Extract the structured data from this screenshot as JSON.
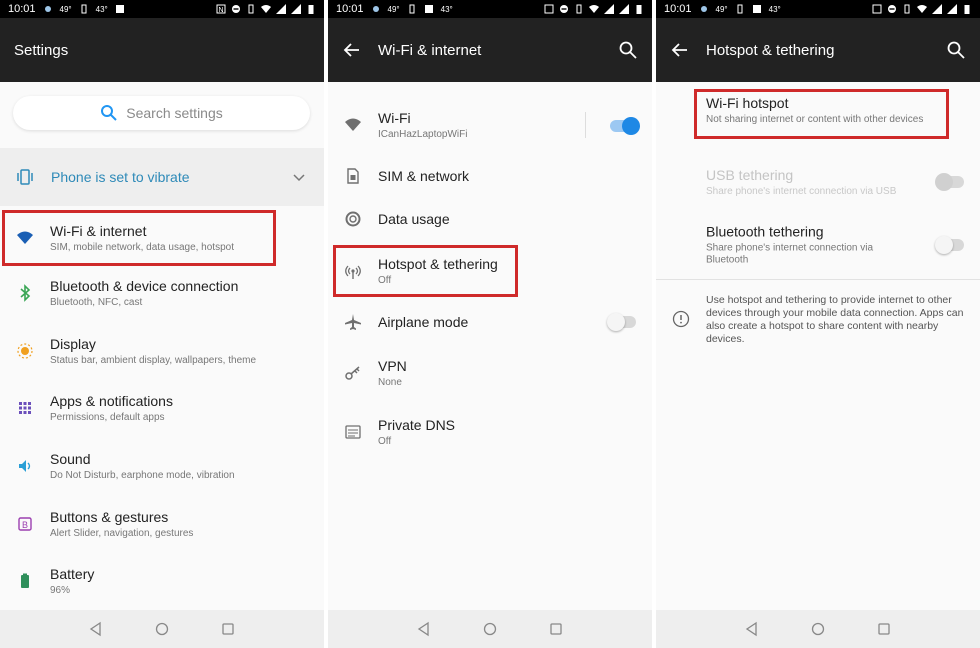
{
  "status": {
    "time": "10:01",
    "temp1": "49°",
    "temp2": "43°"
  },
  "panel1": {
    "title": "Settings",
    "search_placeholder": "Search settings",
    "vibrate_text": "Phone is set to vibrate",
    "items": [
      {
        "title": "Wi-Fi & internet",
        "sub": "SIM, mobile network, data usage, hotspot",
        "icon": "wifi-icon",
        "color": "#1a5fb4"
      },
      {
        "title": "Bluetooth & device connection",
        "sub": "Bluetooth, NFC, cast",
        "icon": "bluetooth-icon",
        "color": "#3aa655"
      },
      {
        "title": "Display",
        "sub": "Status bar, ambient display, wallpapers, theme",
        "icon": "brightness-icon",
        "color": "#f0a020"
      },
      {
        "title": "Apps & notifications",
        "sub": "Permissions, default apps",
        "icon": "apps-icon",
        "color": "#6b4fbb"
      },
      {
        "title": "Sound",
        "sub": "Do Not Disturb, earphone mode, vibration",
        "icon": "volume-icon",
        "color": "#2a9fd6"
      },
      {
        "title": "Buttons & gestures",
        "sub": "Alert Slider, navigation, gestures",
        "icon": "buttons-icon",
        "color": "#9b3fb0"
      },
      {
        "title": "Battery",
        "sub": "96%",
        "icon": "battery-icon",
        "color": "#2f8f5b"
      }
    ]
  },
  "panel2": {
    "title": "Wi-Fi & internet",
    "items": [
      {
        "title": "Wi-Fi",
        "sub": "ICanHazLaptopWiFi",
        "icon": "wifi-icon"
      },
      {
        "title": "SIM & network",
        "sub": "",
        "icon": "sim-icon"
      },
      {
        "title": "Data usage",
        "sub": "",
        "icon": "data-usage-icon"
      },
      {
        "title": "Hotspot & tethering",
        "sub": "Off",
        "icon": "hotspot-icon"
      },
      {
        "title": "Airplane mode",
        "sub": "",
        "icon": "airplane-icon"
      },
      {
        "title": "VPN",
        "sub": "None",
        "icon": "vpn-key-icon"
      },
      {
        "title": "Private DNS",
        "sub": "Off",
        "icon": "dns-icon"
      }
    ],
    "wifi_toggle_on": true,
    "airplane_toggle_on": false
  },
  "panel3": {
    "title": "Hotspot & tethering",
    "items": [
      {
        "title": "Wi-Fi hotspot",
        "sub": "Not sharing internet or content with other devices"
      },
      {
        "title": "USB tethering",
        "sub": "Share phone's internet connection via USB"
      },
      {
        "title": "Bluetooth tethering",
        "sub": "Share phone's internet connection via Bluetooth"
      }
    ],
    "info": "Use hotspot and tethering to provide internet to other devices through your mobile data connection. Apps can also create a hotspot to share content with nearby devices."
  },
  "colors": {
    "accent": "#1e88e5",
    "highlight": "#cf2a2a",
    "appbar": "#222222"
  }
}
